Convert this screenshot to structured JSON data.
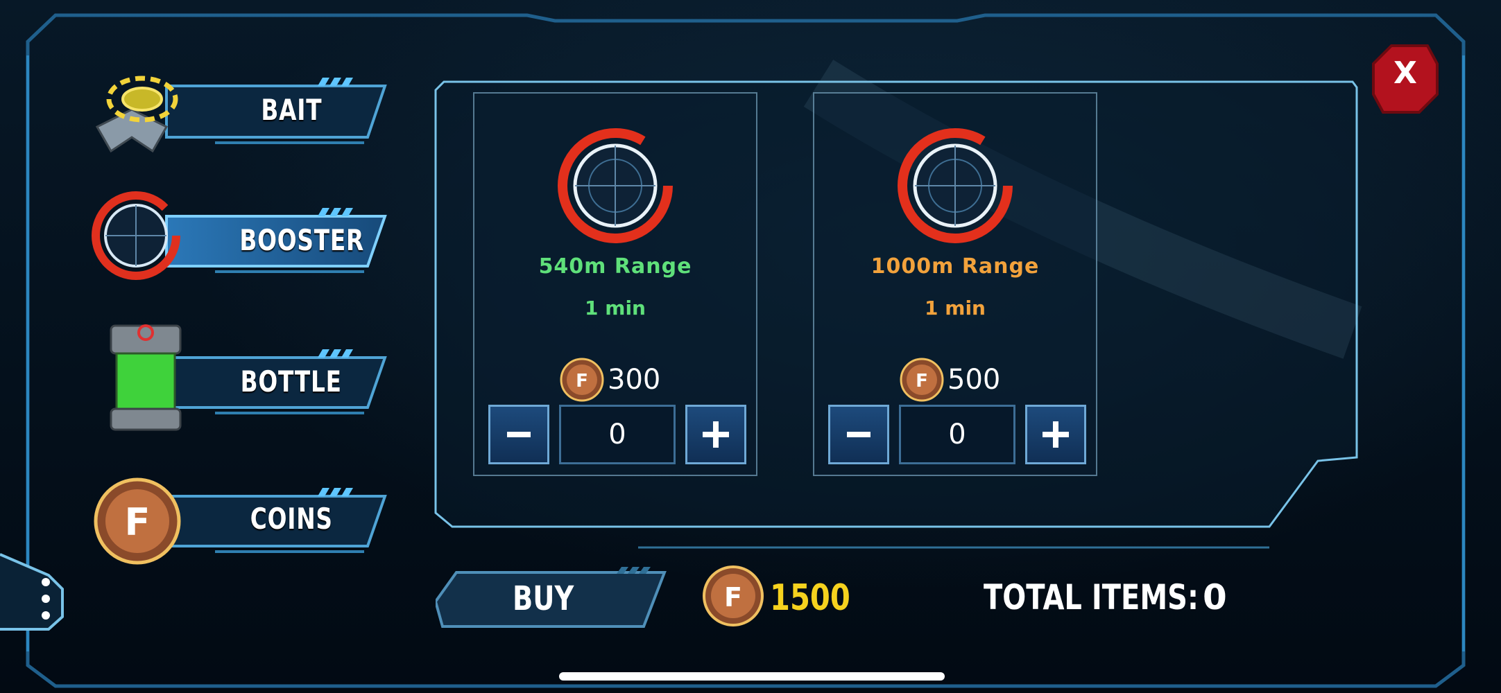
{
  "sidebar": {
    "items": [
      {
        "label": "BAIT",
        "icon": "bait-device-icon"
      },
      {
        "label": "BOOSTER",
        "icon": "booster-range-icon"
      },
      {
        "label": "BOTTLE",
        "icon": "bottle-canister-icon"
      },
      {
        "label": "COINS",
        "icon": "coin-icon"
      }
    ],
    "selected": "BOOSTER"
  },
  "cards": [
    {
      "range": "540m Range",
      "duration": "1 min",
      "price": "300",
      "quantity": "0",
      "color": "#5fe07a"
    },
    {
      "range": "1000m Range",
      "duration": "1 min",
      "price": "500",
      "quantity": "0",
      "color": "#f2a23c"
    }
  ],
  "stepper": {
    "minus": "−",
    "plus": "+"
  },
  "footer": {
    "buy_label": "BUY",
    "balance": "1500",
    "total_label": "TOTAL ITEMS:",
    "total_value": "0"
  },
  "close_label": "X",
  "colors": {
    "accent": "#4fc6ff",
    "gold": "#f6d21e",
    "close": "#b3121e"
  }
}
